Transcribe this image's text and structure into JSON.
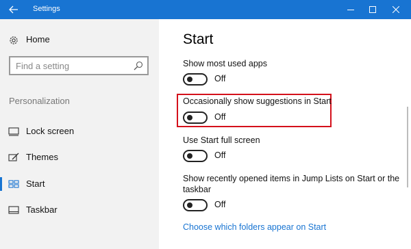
{
  "window": {
    "title": "Settings",
    "accent": "#1874d2",
    "highlight_color": "#d4101b"
  },
  "sidebar": {
    "home_label": "Home",
    "search_placeholder": "Find a setting",
    "section_label": "Personalization",
    "items": [
      {
        "label": "Lock screen",
        "icon": "lock-screen-icon"
      },
      {
        "label": "Themes",
        "icon": "themes-icon"
      },
      {
        "label": "Start",
        "icon": "start-icon",
        "selected": true
      },
      {
        "label": "Taskbar",
        "icon": "taskbar-icon"
      }
    ]
  },
  "main": {
    "title": "Start",
    "settings": [
      {
        "label": "Show most used apps",
        "state": "Off"
      },
      {
        "label": "Occasionally show suggestions in Start",
        "state": "Off",
        "highlighted": true
      },
      {
        "label": "Use Start full screen",
        "state": "Off"
      },
      {
        "label": "Show recently opened items in Jump Lists on Start or the taskbar",
        "state": "Off"
      }
    ],
    "link_text": "Choose which folders appear on Start"
  }
}
